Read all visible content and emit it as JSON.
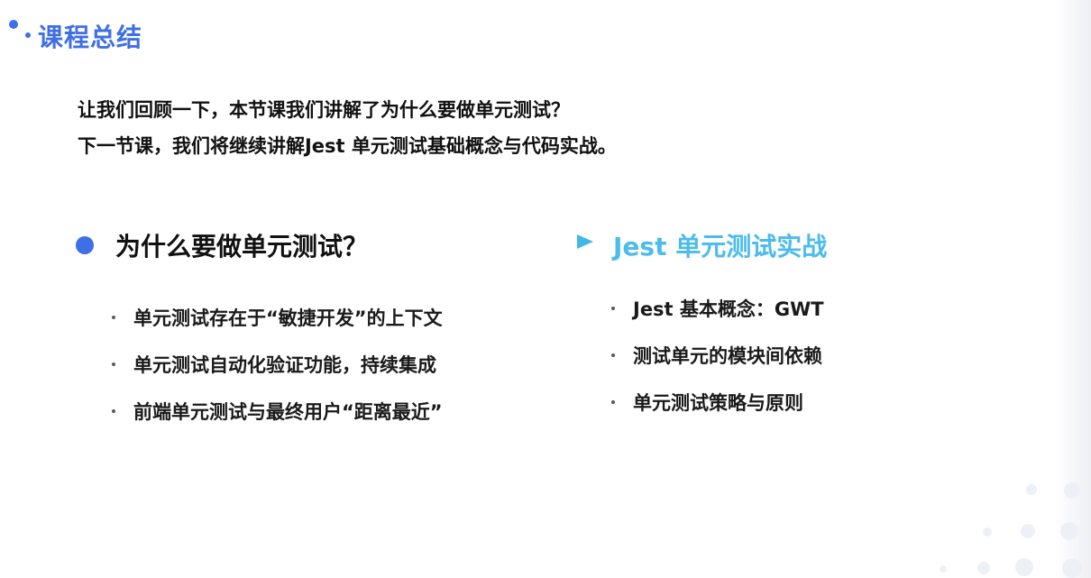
{
  "title": "课程总结",
  "intro": {
    "line1": "让我们回顾一下，本节课我们讲解了为什么要做单元测试？",
    "line2": "下一节课，我们将继续讲解Jest 单元测试基础概念与代码实战。"
  },
  "left": {
    "heading": "为什么要做单元测试？",
    "items": [
      "单元测试存在于“敏捷开发”的上下文",
      "单元测试自动化验证功能，持续集成",
      "前端单元测试与最终用户“距离最近”"
    ]
  },
  "right": {
    "heading": "Jest 单元测试实战",
    "items": [
      "Jest 基本概念：GWT",
      "测试单元的模块间依赖",
      "单元测试策略与原则"
    ]
  },
  "colors": {
    "title": "#3f6fe6",
    "left_marker": "#3f6fe6",
    "right_heading": "#4cbcec"
  }
}
